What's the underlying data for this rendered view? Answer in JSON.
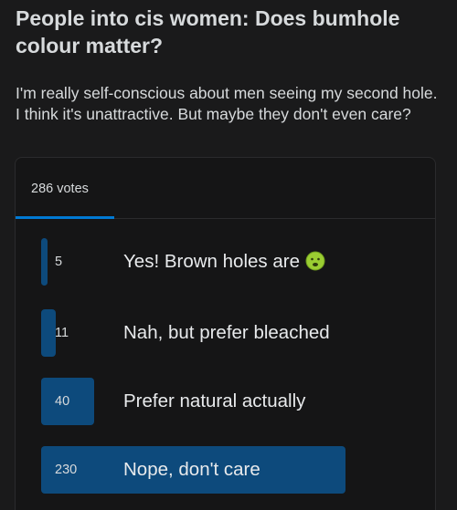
{
  "post": {
    "title": "People into cis women: Does bumhole colour matter?",
    "body": "I'm really self-conscious about men seeing my second hole. I think it's unattractive. But maybe they don't even care?"
  },
  "poll": {
    "total_votes_label": "286 votes",
    "options": [
      {
        "count": "5",
        "label": "Yes! Brown holes are",
        "votes": 5,
        "icon": "nauseated-face-icon"
      },
      {
        "count": "11",
        "label": "Nah, but prefer bleached",
        "votes": 11
      },
      {
        "count": "40",
        "label": "Prefer natural actually",
        "votes": 40
      },
      {
        "count": "230",
        "label": "Nope, don't care",
        "votes": 230
      }
    ],
    "colors": {
      "bar": "#0d4a7c",
      "tab_accent": "#0079d3",
      "background": "#1a1a1b"
    }
  }
}
